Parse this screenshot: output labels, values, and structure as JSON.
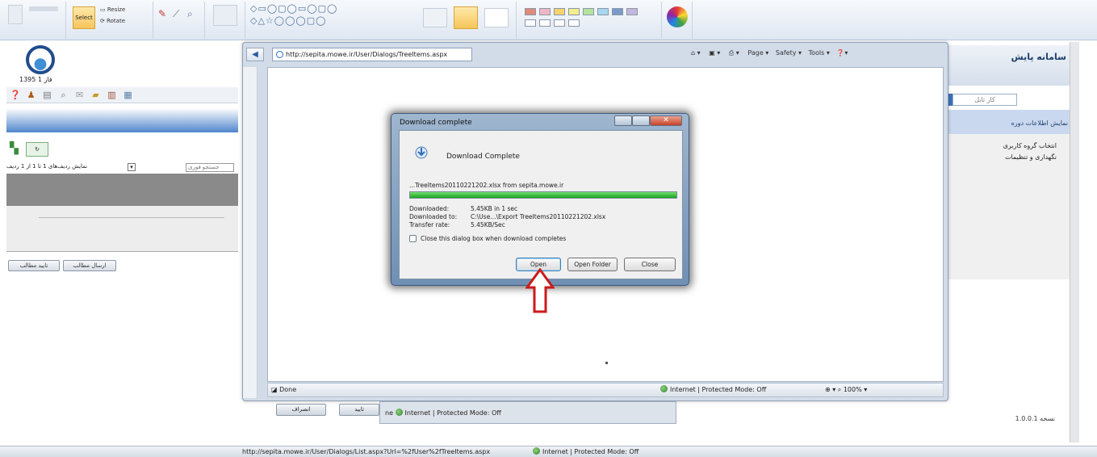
{
  "ribbon": {
    "select_label": "Select",
    "resize_label": "Resize",
    "rotate_label": "Rotate",
    "colors_label": "Colors",
    "edit_colors_label": "Edit colors"
  },
  "left_app": {
    "version_text": "1395 فاز 1",
    "filter_text": "نمایش ردیف‌های 1 تا 1 از 1 ردیف",
    "search_placeholder": "جستجو فوری",
    "button_1": "تایید مطالب",
    "button_2": "ارسال مطالب"
  },
  "right_app": {
    "title": "سامانه پایش",
    "tab_label": "کار تابل",
    "item_1": "نمایش اطلاعات دوره",
    "item_2": "انتخاب گروه کاربری",
    "item_3": "نگهداری و تنظیمات",
    "footer_text": "نسخه 1.0.0.1"
  },
  "ie": {
    "address": "http://sepita.mowe.ir/User/Dialogs/TreeItems.aspx",
    "cmd_page": "Page",
    "cmd_safety": "Safety",
    "cmd_tools": "Tools",
    "status_done": "Done",
    "status_zone": "Internet | Protected Mode: Off",
    "zoom": "100%"
  },
  "dialog": {
    "title": "Download complete",
    "heading": "Download Complete",
    "filename": "...TreeItems20110221202.xlsx from sepita.mowe.ir",
    "progress": 1.0,
    "downloaded_label": "Downloaded:",
    "downloaded_value": "5.45KB in 1 sec",
    "downloaded_to_label": "Downloaded to:",
    "downloaded_to_value": "C:\\Use...\\Export TreeItems20110221202.xlsx",
    "rate_label": "Transfer rate:",
    "rate_value": "5.45KB/Sec",
    "checkbox_label": "Close this dialog box when download completes",
    "open_btn": "Open",
    "open_folder_btn": "Open Folder",
    "close_btn": "Close"
  },
  "back_window": {
    "status_zone": "Internet | Protected Mode: Off",
    "btn_1": "انصراف",
    "btn_2": "تایید"
  },
  "main_status": {
    "url": "http://sepita.mowe.ir/User/Dialogs/List.aspx?Url=%2fUser%2fTreeItems.aspx",
    "zone": "Internet | Protected Mode: Off"
  },
  "colors": {
    "accent": "#1f4c8c",
    "progress": "#1ea31e",
    "arrow": "#cc1a1a"
  }
}
